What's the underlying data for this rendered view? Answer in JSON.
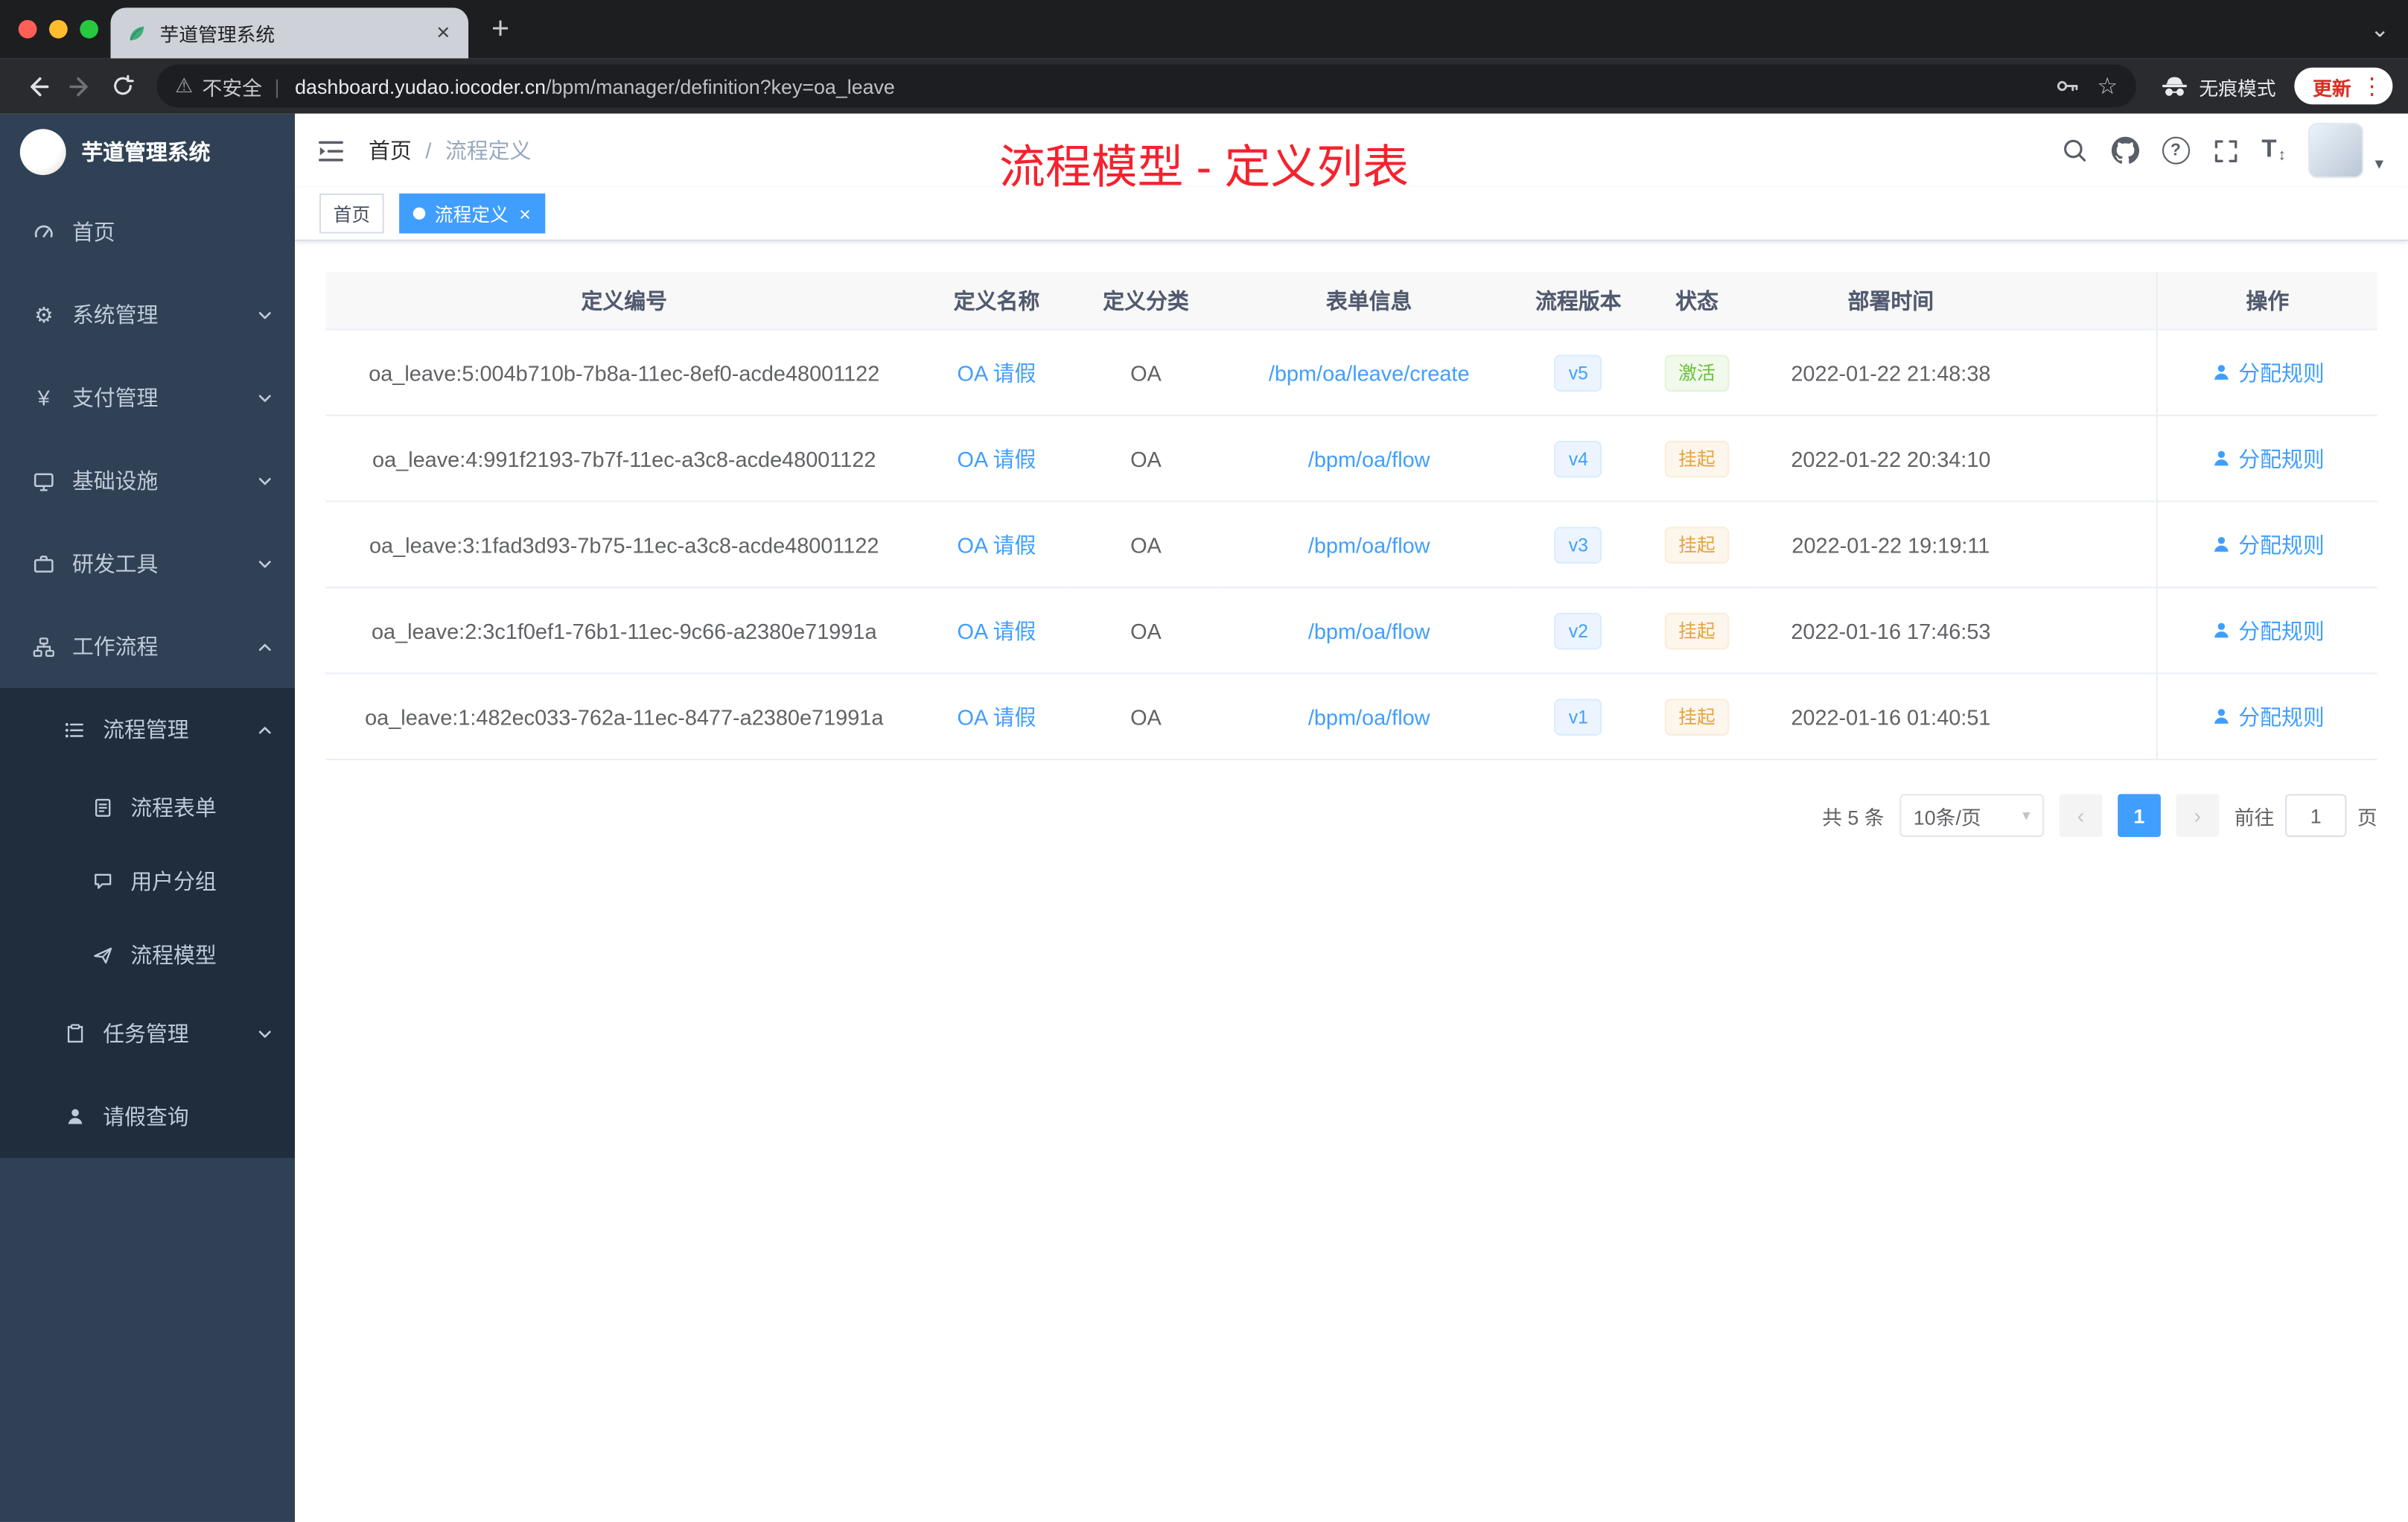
{
  "browser": {
    "tab_title": "芋道管理系统",
    "security_label": "不安全",
    "url_host": "dashboard.yudao.iocoder.cn",
    "url_path": "/bpm/manager/definition?key=oa_leave",
    "incognito_label": "无痕模式",
    "update_label": "更新"
  },
  "icons": {
    "warning": "⚠",
    "star": "☆",
    "kebab": "⋮",
    "plus": "+",
    "close": "×",
    "tab_caret": "⌄",
    "avatar_caret": "▾",
    "gear": "⚙",
    "yen": "¥",
    "question": "?",
    "font_size": "T",
    "font_arrows": "↕",
    "breadcrumb_sep": "/",
    "select_caret": "▾",
    "prev": "‹",
    "next": "›",
    "url_sep": "|"
  },
  "sidebar": {
    "logo_title": "芋道管理系统",
    "items": [
      {
        "label": "首页"
      },
      {
        "label": "系统管理"
      },
      {
        "label": "支付管理"
      },
      {
        "label": "基础设施"
      },
      {
        "label": "研发工具"
      },
      {
        "label": "工作流程"
      },
      {
        "label": "流程管理"
      },
      {
        "label": "流程表单"
      },
      {
        "label": "用户分组"
      },
      {
        "label": "流程模型"
      },
      {
        "label": "任务管理"
      },
      {
        "label": "请假查询"
      }
    ]
  },
  "navbar": {
    "breadcrumb": {
      "home": "首页",
      "current": "流程定义"
    },
    "annotation": "流程模型 - 定义列表"
  },
  "tags": {
    "home": "首页",
    "active": "流程定义"
  },
  "table": {
    "columns": {
      "id": "定义编号",
      "name": "定义名称",
      "category": "定义分类",
      "form": "表单信息",
      "version": "流程版本",
      "status": "状态",
      "deploy_time": "部署时间",
      "actions": "操作"
    },
    "rows": [
      {
        "id": "oa_leave:5:004b710b-7b8a-11ec-8ef0-acde48001122",
        "name": "OA 请假",
        "category": "OA",
        "form": "/bpm/oa/leave/create",
        "version": "v5",
        "status": "激活",
        "status_type": "success",
        "deploy_time": "2022-01-22 21:48:38",
        "action": "分配规则"
      },
      {
        "id": "oa_leave:4:991f2193-7b7f-11ec-a3c8-acde48001122",
        "name": "OA 请假",
        "category": "OA",
        "form": "/bpm/oa/flow",
        "version": "v4",
        "status": "挂起",
        "status_type": "warning",
        "deploy_time": "2022-01-22 20:34:10",
        "action": "分配规则"
      },
      {
        "id": "oa_leave:3:1fad3d93-7b75-11ec-a3c8-acde48001122",
        "name": "OA 请假",
        "category": "OA",
        "form": "/bpm/oa/flow",
        "version": "v3",
        "status": "挂起",
        "status_type": "warning",
        "deploy_time": "2022-01-22 19:19:11",
        "action": "分配规则"
      },
      {
        "id": "oa_leave:2:3c1f0ef1-76b1-11ec-9c66-a2380e71991a",
        "name": "OA 请假",
        "category": "OA",
        "form": "/bpm/oa/flow",
        "version": "v2",
        "status": "挂起",
        "status_type": "warning",
        "deploy_time": "2022-01-16 17:46:53",
        "action": "分配规则"
      },
      {
        "id": "oa_leave:1:482ec033-762a-11ec-8477-a2380e71991a",
        "name": "OA 请假",
        "category": "OA",
        "form": "/bpm/oa/flow",
        "version": "v1",
        "status": "挂起",
        "status_type": "warning",
        "deploy_time": "2022-01-16 01:40:51",
        "action": "分配规则"
      }
    ]
  },
  "pagination": {
    "total": "共 5 条",
    "page_size": "10条/页",
    "page": "1",
    "goto_label": "前往",
    "goto_value": "1",
    "goto_unit": "页"
  },
  "colors": {
    "accent": "#409eff",
    "annotation_red": "#f5222d",
    "success": "#67c23a",
    "warning": "#e6a23c",
    "sidebar_bg": "#304156",
    "submenu_bg": "#1f2d3d"
  }
}
